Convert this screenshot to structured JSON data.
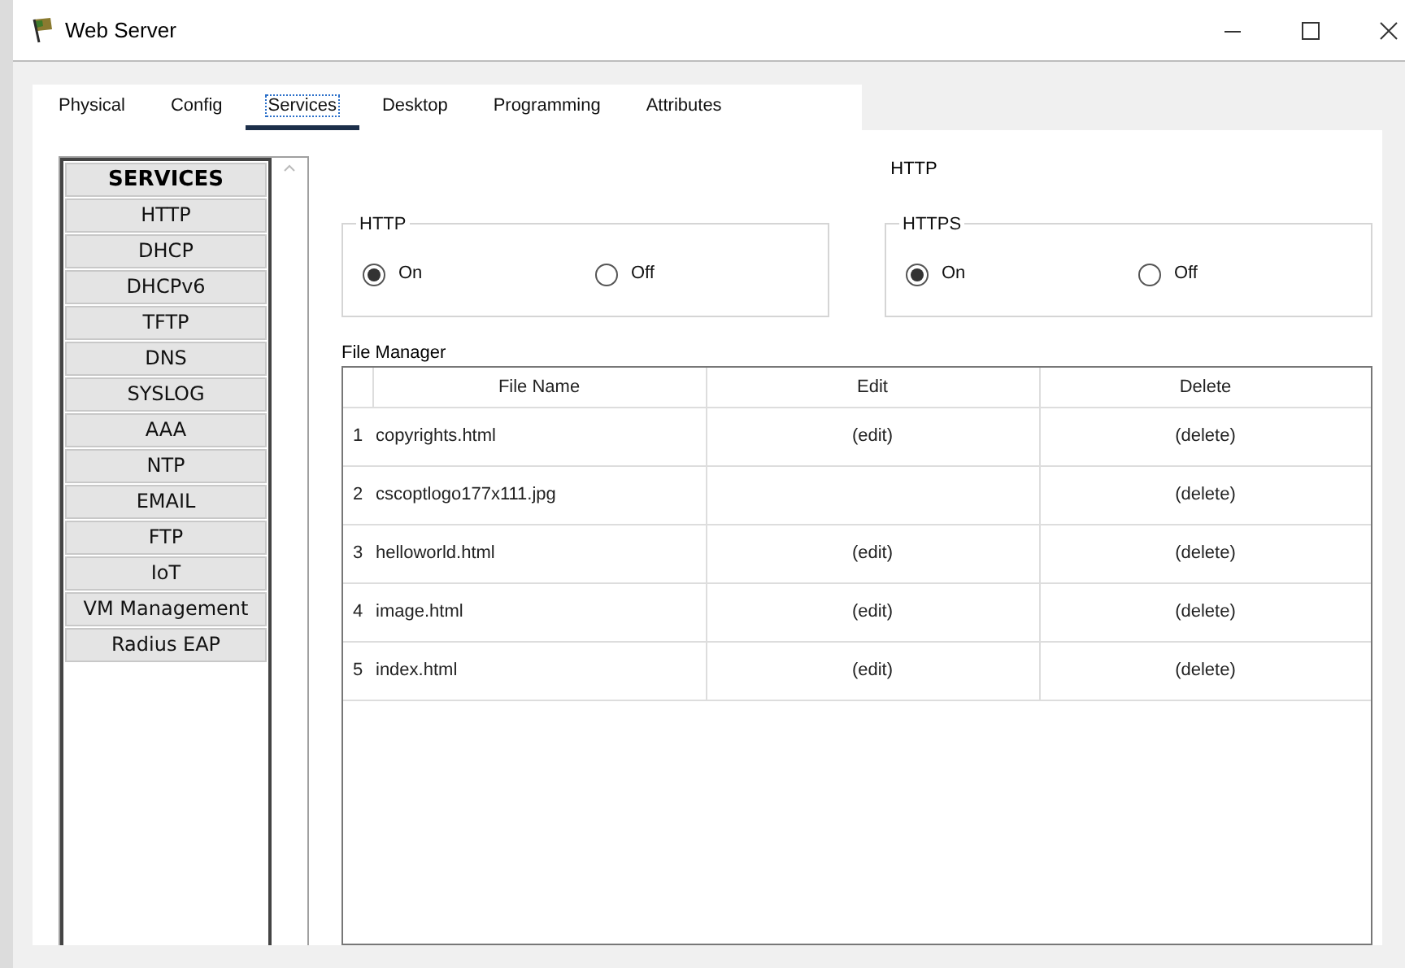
{
  "window": {
    "title": "Web Server"
  },
  "tabs": [
    {
      "label": "Physical",
      "selected": false
    },
    {
      "label": "Config",
      "selected": false
    },
    {
      "label": "Services",
      "selected": true
    },
    {
      "label": "Desktop",
      "selected": false
    },
    {
      "label": "Programming",
      "selected": false
    },
    {
      "label": "Attributes",
      "selected": false
    }
  ],
  "sidebar": {
    "header": "SERVICES",
    "items": [
      {
        "label": "HTTP"
      },
      {
        "label": "DHCP"
      },
      {
        "label": "DHCPv6"
      },
      {
        "label": "TFTP"
      },
      {
        "label": "DNS"
      },
      {
        "label": "SYSLOG"
      },
      {
        "label": "AAA"
      },
      {
        "label": "NTP"
      },
      {
        "label": "EMAIL"
      },
      {
        "label": "FTP"
      },
      {
        "label": "IoT"
      },
      {
        "label": "VM Management"
      },
      {
        "label": "Radius EAP"
      }
    ]
  },
  "panel_title": "HTTP",
  "groups": [
    {
      "title": "HTTP",
      "options": [
        {
          "label": "On",
          "selected": true
        },
        {
          "label": "Off",
          "selected": false
        }
      ]
    },
    {
      "title": "HTTPS",
      "options": [
        {
          "label": "On",
          "selected": true
        },
        {
          "label": "Off",
          "selected": false
        }
      ]
    }
  ],
  "file_manager": {
    "title": "File Manager",
    "columns": [
      "File Name",
      "Edit",
      "Delete"
    ],
    "rows": [
      {
        "index": "1",
        "name": "copyrights.html",
        "edit": "(edit)",
        "delete": "(delete)"
      },
      {
        "index": "2",
        "name": "cscoptlogo177x111.jpg",
        "delete": "(delete)"
      },
      {
        "index": "3",
        "name": "helloworld.html",
        "edit": "(edit)",
        "delete": "(delete)"
      },
      {
        "index": "4",
        "name": "image.html",
        "edit": "(edit)",
        "delete": "(delete)"
      },
      {
        "index": "5",
        "name": "index.html",
        "edit": "(edit)",
        "delete": "(delete)"
      }
    ]
  }
}
